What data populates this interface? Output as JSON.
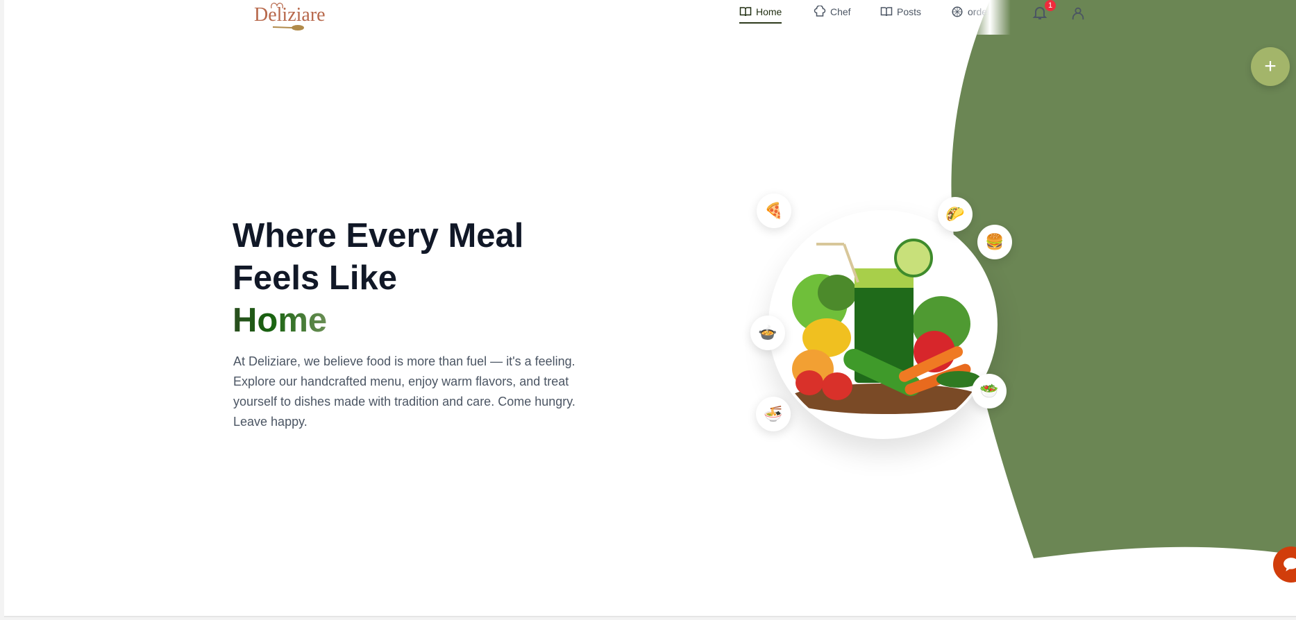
{
  "brand": {
    "name": "Deliziare"
  },
  "nav": {
    "items": [
      {
        "label": "Home",
        "icon": "book-open-icon"
      },
      {
        "label": "Chef",
        "icon": "chef-hat-icon"
      },
      {
        "label": "Posts",
        "icon": "book-open-icon"
      },
      {
        "label": "order",
        "icon": "order-icon"
      }
    ],
    "active": "Home"
  },
  "notifications": {
    "count": "1"
  },
  "hero": {
    "title_line1": "Where Every Meal",
    "title_line2": "Feels Like",
    "title_highlight": "Home",
    "description": "At Deliziare, we believe food is more than fuel — it's a feeling. Explore our handcrafted menu, enjoy warm flavors, and treat yourself to dishes made with tradition and care. Come hungry. Leave happy."
  },
  "food_icons": [
    "🍕",
    "🌮",
    "🍔",
    "🍲",
    "🥗",
    "🍜"
  ],
  "fab": {
    "label": "+"
  },
  "colors": {
    "accent": "#6b8654",
    "fab": "#a3b56a",
    "chat": "#d13d0b",
    "badge": "#ef2b3c"
  }
}
